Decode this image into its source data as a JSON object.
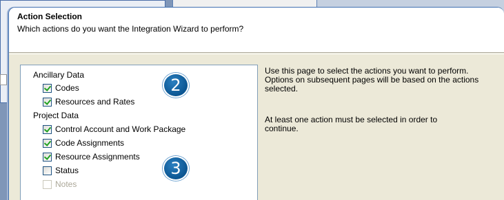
{
  "header": {
    "title": "Action Selection",
    "subtitle": "Which actions do you want the Integration Wizard to perform?"
  },
  "tree": {
    "groups": [
      {
        "label": "Ancillary Data",
        "items": [
          {
            "label": "Codes",
            "checked": true,
            "enabled": true
          },
          {
            "label": "Resources and Rates",
            "checked": true,
            "enabled": true
          }
        ]
      },
      {
        "label": "Project Data",
        "items": [
          {
            "label": "Control Account and Work Package",
            "checked": true,
            "enabled": true
          },
          {
            "label": "Code Assignments",
            "checked": true,
            "enabled": true
          },
          {
            "label": "Resource Assignments",
            "checked": true,
            "enabled": true
          },
          {
            "label": "Status",
            "checked": false,
            "enabled": true
          },
          {
            "label": "Notes",
            "checked": false,
            "enabled": false
          }
        ]
      }
    ]
  },
  "description": {
    "line1": "Use this page to select the actions you want to perform.",
    "line2": "Options on subsequent pages will be based on the actions",
    "line3": "selected.",
    "line4": "At least one action must be selected in order to",
    "line5": "continue."
  },
  "callouts": {
    "first": "2",
    "second": "3"
  },
  "colors": {
    "accent": "#0b5591",
    "check": "#21a121",
    "dialog_bg": "#ece9d8"
  }
}
